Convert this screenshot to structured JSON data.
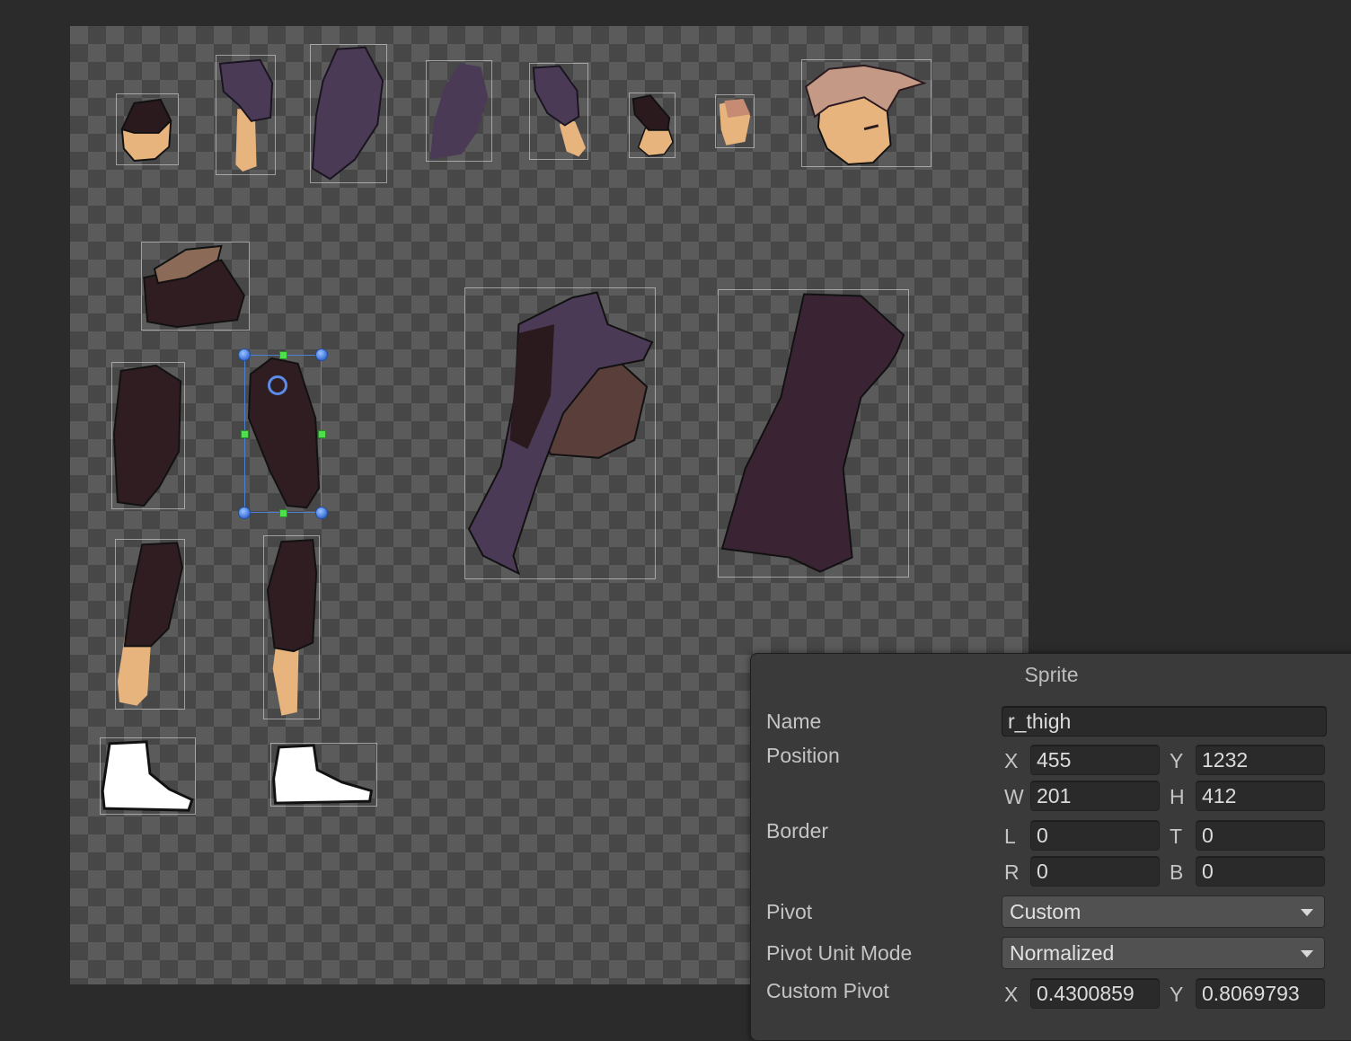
{
  "sprite_panel": {
    "title": "Sprite",
    "name_label": "Name",
    "name_value": "r_thigh",
    "position_label": "Position",
    "position": {
      "x_label": "X",
      "x": "455",
      "y_label": "Y",
      "y": "1232",
      "w_label": "W",
      "w": "201",
      "h_label": "H",
      "h": "412"
    },
    "border_label": "Border",
    "border": {
      "l_label": "L",
      "l": "0",
      "t_label": "T",
      "t": "0",
      "r_label": "R",
      "r": "0",
      "b_label": "B",
      "b": "0"
    },
    "pivot_label": "Pivot",
    "pivot_value": "Custom",
    "pivot_unit_mode_label": "Pivot Unit Mode",
    "pivot_unit_mode_value": "Normalized",
    "custom_pivot_label": "Custom Pivot",
    "custom_pivot": {
      "x_label": "X",
      "x": "0.4300859",
      "y_label": "Y",
      "y": "0.8069793"
    }
  },
  "colors": {
    "canvas_checker_light": "#5b5b5b",
    "canvas_checker_dark": "#474747",
    "panel_bg": "#3a3a3a",
    "selection_handle": "#3a6fd8",
    "edge_handle": "#4ee04a",
    "dark_cloth": "#2f1d22",
    "purple_cloth": "#4a3a55",
    "skin": "#e7b47e"
  },
  "sprites": [
    {
      "icon": "glove-hand-sprite"
    },
    {
      "icon": "forearm-sleeve-sprite"
    },
    {
      "icon": "upper-arm-sprite"
    },
    {
      "icon": "upper-arm-back-sprite"
    },
    {
      "icon": "forearm-sprite"
    },
    {
      "icon": "glove-hand-back-sprite"
    },
    {
      "icon": "finger-sprite"
    },
    {
      "icon": "head-sprite"
    },
    {
      "icon": "pelvis-sprite"
    },
    {
      "icon": "l-thigh-sprite"
    },
    {
      "icon": "r-thigh-sprite",
      "selected": true
    },
    {
      "icon": "torso-sprite"
    },
    {
      "icon": "coat-sprite"
    },
    {
      "icon": "l-shin-sprite"
    },
    {
      "icon": "r-shin-sprite"
    },
    {
      "icon": "l-foot-sprite"
    },
    {
      "icon": "r-foot-sprite"
    }
  ]
}
